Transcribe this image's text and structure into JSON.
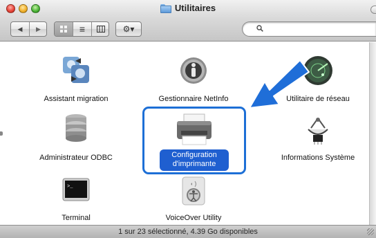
{
  "window": {
    "title": "Utilitaires",
    "status": "1 sur 23 sélectionné, 4.39 Go disponibles"
  },
  "toolbar": {
    "back_icon": "◀",
    "forward_icon": "▶",
    "view_icons_icon": "icon-view-icon",
    "view_list_icon": "≡",
    "view_columns_icon": "column-view-icon",
    "action_icon": "⚙▾",
    "search_placeholder": ""
  },
  "items": [
    {
      "label": "Assistant migration",
      "icon": "migration-assistant-icon"
    },
    {
      "label": "Gestionnaire NetInfo",
      "icon": "netinfo-manager-icon"
    },
    {
      "label": "Utilitaire de réseau",
      "icon": "network-utility-icon"
    },
    {
      "label": "Administrateur ODBC",
      "icon": "odbc-admin-icon"
    },
    {
      "label": "Configuration d'imprimante",
      "line1": "Configuration",
      "line2": "d'imprimante",
      "icon": "printer-setup-icon",
      "selected": true
    },
    {
      "label": "Informations Système",
      "icon": "system-profiler-icon"
    },
    {
      "label": "Terminal",
      "icon": "terminal-icon"
    },
    {
      "label": "VoiceOver Utility",
      "icon": "voiceover-utility-icon"
    }
  ],
  "annotation": {
    "arrow_color": "#1f6ed8",
    "frame_color": "#1d6fd6"
  }
}
